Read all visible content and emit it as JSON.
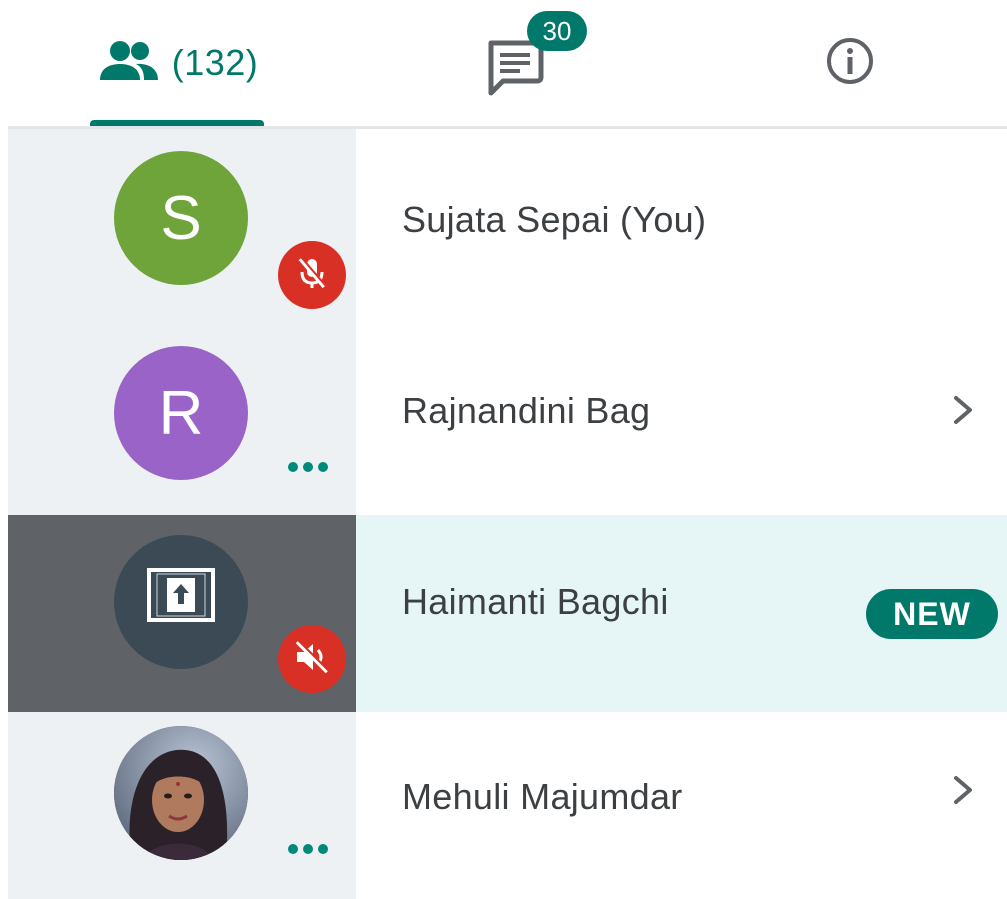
{
  "tabs": {
    "people": {
      "count_label": "(132)",
      "icon": "people-icon"
    },
    "chat": {
      "badge_count": "30",
      "icon": "chat-icon"
    },
    "info": {
      "icon": "info-icon"
    }
  },
  "participants": [
    {
      "initial": "S",
      "name": "Sujata Sepai (You)",
      "avatar_color": "#6ea43a",
      "status": "mic-off"
    },
    {
      "initial": "R",
      "name": "Rajnandini Bag",
      "avatar_color": "#9a63c8",
      "status": "more"
    },
    {
      "initial": "",
      "name": "Haimanti Bagchi",
      "avatar_color": "#3b4a55",
      "status": "audio-off",
      "badge": "NEW",
      "presenting": true
    },
    {
      "initial": "",
      "name": "Mehuli Majumdar",
      "avatar_color": "#4a4a52",
      "status": "more",
      "photo": true
    }
  ],
  "colors": {
    "accent": "#00796b",
    "mute_red": "#d93025",
    "highlight_row": "#e6f6f6",
    "left_panel": "#eef1f3"
  }
}
